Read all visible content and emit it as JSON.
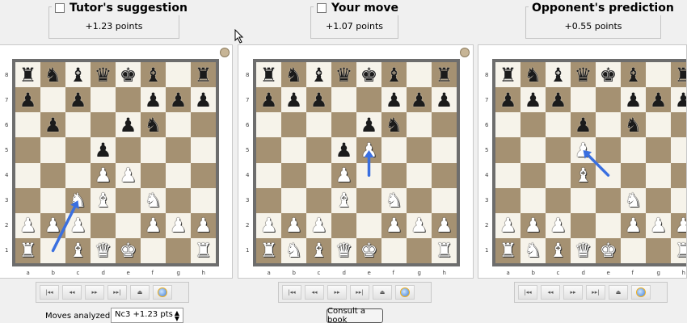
{
  "headers": [
    {
      "title": "Tutor's suggestion",
      "points": "+1.23 points"
    },
    {
      "title": "Your move",
      "points": "+1.07 points"
    },
    {
      "title": "Opponent's prediction",
      "points": "+0.55 points"
    }
  ],
  "boards": [
    {
      "rows": [
        "r n b q k b . r",
        "p . p . . p p p",
        ". p . . p n . .",
        ". . . p . . . .",
        ". . . P P . . .",
        ". . N B . N . .",
        "P P P . . P P P",
        "R . B Q K . . R"
      ],
      "arrow": {
        "from": "b1",
        "to": "c3"
      }
    },
    {
      "rows": [
        "r n b q k b . r",
        "p p p . . p p p",
        ". . . . p n . .",
        ". . . p P . . .",
        ". . . P . . . .",
        ". . . B . N . .",
        "P P P . . P P P",
        "R N B Q K . . R"
      ],
      "arrow": {
        "from": "e4",
        "to": "e5"
      }
    },
    {
      "rows": [
        "r n b q k b . r",
        "p p p . . p p p",
        ". . . p . n . .",
        ". . . P . . . .",
        ". . . B . . . .",
        ". . . . . N . .",
        "P P P . . P P P",
        "R N B Q K . . R"
      ],
      "arrow": {
        "from": "e4",
        "to": "d5"
      }
    }
  ],
  "files": [
    "a",
    "b",
    "c",
    "d",
    "e",
    "f",
    "g",
    "h"
  ],
  "ranks": [
    "8",
    "7",
    "6",
    "5",
    "4",
    "3",
    "2",
    "1"
  ],
  "nav_icons": [
    "first-icon",
    "prev-icon",
    "next-icon",
    "last-icon",
    "eject-icon",
    "engine-icon"
  ],
  "nav_glyphs": [
    "|◂◂",
    "◂◂",
    "▸▸",
    "▸▸|",
    "⏏",
    ""
  ],
  "footer": {
    "moves_label": "Moves analyzed :",
    "moves_value": "Nc3 +1.23 pts",
    "consult_label": "Consult a book"
  },
  "colors": {
    "arrow": "#3a6fe0",
    "light_square": "#f6f3ea",
    "dark_square": "#a59172",
    "frame": "#6d6d6d"
  }
}
